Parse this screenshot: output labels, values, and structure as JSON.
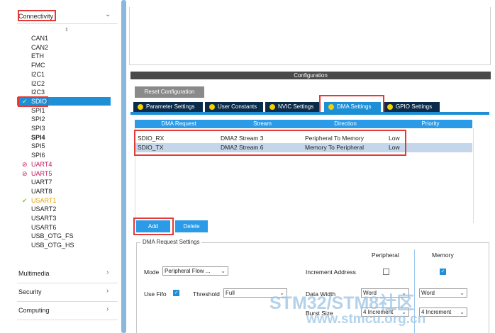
{
  "sidebar": {
    "categories": {
      "connectivity": "Connectivity",
      "multimedia": "Multimedia",
      "security": "Security",
      "computing": "Computing"
    },
    "sort_icon": "sort-arrows-icon",
    "items": [
      {
        "label": "CAN1",
        "status": ""
      },
      {
        "label": "CAN2",
        "status": ""
      },
      {
        "label": "ETH",
        "status": ""
      },
      {
        "label": "FMC",
        "status": ""
      },
      {
        "label": "I2C1",
        "status": ""
      },
      {
        "label": "I2C2",
        "status": ""
      },
      {
        "label": "I2C3",
        "status": ""
      },
      {
        "label": "SDIO",
        "status": "ok-selected"
      },
      {
        "label": "SPI1",
        "status": ""
      },
      {
        "label": "SPI2",
        "status": ""
      },
      {
        "label": "SPI3",
        "status": ""
      },
      {
        "label": "SPI4",
        "status": "bold"
      },
      {
        "label": "SPI5",
        "status": ""
      },
      {
        "label": "SPI6",
        "status": ""
      },
      {
        "label": "UART4",
        "status": "blocked"
      },
      {
        "label": "UART5",
        "status": "blocked"
      },
      {
        "label": "UART7",
        "status": ""
      },
      {
        "label": "UART8",
        "status": ""
      },
      {
        "label": "USART1",
        "status": "ok"
      },
      {
        "label": "USART2",
        "status": ""
      },
      {
        "label": "USART3",
        "status": ""
      },
      {
        "label": "USART6",
        "status": ""
      },
      {
        "label": "USB_OTG_FS",
        "status": ""
      },
      {
        "label": "USB_OTG_HS",
        "status": ""
      }
    ]
  },
  "config": {
    "header": "Configuration",
    "reset_button": "Reset Configuration",
    "tabs": [
      "Parameter Settings",
      "User Constants",
      "NVIC Settings",
      "DMA Settings",
      "GPIO Settings"
    ],
    "active_tab": "DMA Settings"
  },
  "dma_table": {
    "columns": [
      "DMA Request",
      "Stream",
      "Direction",
      "Priority"
    ],
    "rows": [
      [
        "SDIO_RX",
        "DMA2 Stream 3",
        "Peripheral To Memory",
        "Low"
      ],
      [
        "SDIO_TX",
        "DMA2 Stream 6",
        "Memory To Peripheral",
        "Low"
      ]
    ],
    "selected_row": 1
  },
  "buttons": {
    "add": "Add",
    "delete": "Delete"
  },
  "settings": {
    "title": "DMA Request Settings",
    "peripheral_header": "Peripheral",
    "memory_header": "Memory",
    "mode_label": "Mode",
    "mode_value": "Peripheral Flow ...",
    "increment_label": "Increment Address",
    "use_fifo_label": "Use Fifo",
    "threshold_label": "Threshold",
    "threshold_value": "Full",
    "data_width_label": "Data Width",
    "data_width_periph": "Word",
    "data_width_mem": "Word",
    "burst_size_label": "Burst Size",
    "burst_periph": "4 Increment",
    "burst_mem": "4 Increment"
  },
  "watermark": {
    "line1": "STM32/STM8社区",
    "line2": "www.stmcu.org.cn"
  },
  "colors": {
    "accent": "#1c8fd6",
    "tab_dark": "#0b2b4a",
    "highlight_box": "#e53935"
  }
}
